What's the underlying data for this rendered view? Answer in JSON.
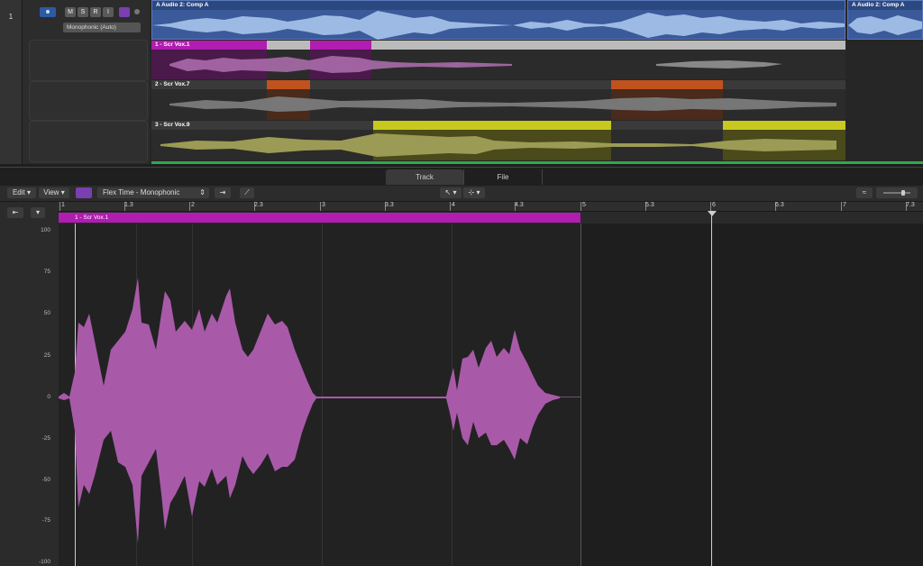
{
  "top": {
    "track_number": "1",
    "buttons": [
      "M",
      "S",
      "R",
      "I"
    ],
    "flex_mode": "Monophonic (Auto)",
    "comp_region_title": "A  Audio 2: Comp A",
    "comp_region_title_2": "A  Audio 2: Comp A",
    "takes": [
      {
        "label": "1 - Scr Vox.1",
        "color": "#b11cb1"
      },
      {
        "label": "2 - Scr Vox.7",
        "color": "#c0521e"
      },
      {
        "label": "3 - Scr Vox.9",
        "color": "#c8c81e"
      }
    ]
  },
  "tabs": {
    "track": "Track",
    "file": "File"
  },
  "toolbar": {
    "edit": "Edit",
    "view": "View",
    "flex_mode_select": "Flex Time - Monophonic"
  },
  "ruler": {
    "ticks": [
      "1",
      "1.3",
      "2",
      "2.3",
      "3",
      "3.3",
      "4",
      "4.3",
      "5",
      "5.3",
      "6",
      "6.3",
      "7",
      "7.3"
    ]
  },
  "region": {
    "label": "1 - Scr Vox.1",
    "color": "#b11cb1"
  },
  "amplitude": {
    "labels": [
      "100",
      "75",
      "50",
      "25",
      "0",
      "-25",
      "-50",
      "-75",
      "-100"
    ]
  },
  "colors": {
    "comp_blue": "#3a5a9a",
    "waveform_pink": "#a85aa8",
    "waveform_blue": "#a8c4ec"
  }
}
